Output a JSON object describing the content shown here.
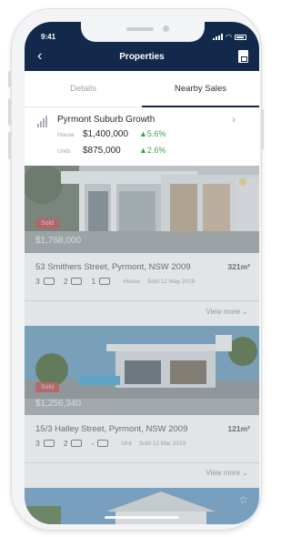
{
  "status_bar": {
    "time": "9:41"
  },
  "header": {
    "title": "Properties",
    "back_icon": "chevron-left-icon",
    "action_icon": "document-icon"
  },
  "tabs": [
    {
      "label": "Details",
      "active": false
    },
    {
      "label": "Nearby Sales",
      "active": true
    }
  ],
  "growth": {
    "title": "Pyrmont Suburb Growth",
    "rows": [
      {
        "label": "House",
        "price": "$1,400,000",
        "change": "▲5.6%"
      },
      {
        "label": "Units",
        "price": "$875,000",
        "change": "▲2.6%"
      }
    ]
  },
  "listings": [
    {
      "badge": "Sold",
      "price": "$1,768,000",
      "address": "53 Smithers Street, Pyrmont, NSW 2009",
      "area": "321m²",
      "beds": "3",
      "baths": "2",
      "cars": "1",
      "type": "House",
      "sold_date": "Sold 12 May 2019",
      "view_more": "View more"
    },
    {
      "badge": "Sold",
      "price": "$1,256,340",
      "address": "15/3 Halley Street, Pyrmont, NSW 2009",
      "area": "121m²",
      "beds": "3",
      "baths": "2",
      "cars": "-",
      "type": "Unit",
      "sold_date": "Sold 12 Mar 2019",
      "view_more": "View more"
    }
  ],
  "colors": {
    "navy": "#13294b",
    "sold": "#c94a4a",
    "growth": "#3da34a"
  }
}
